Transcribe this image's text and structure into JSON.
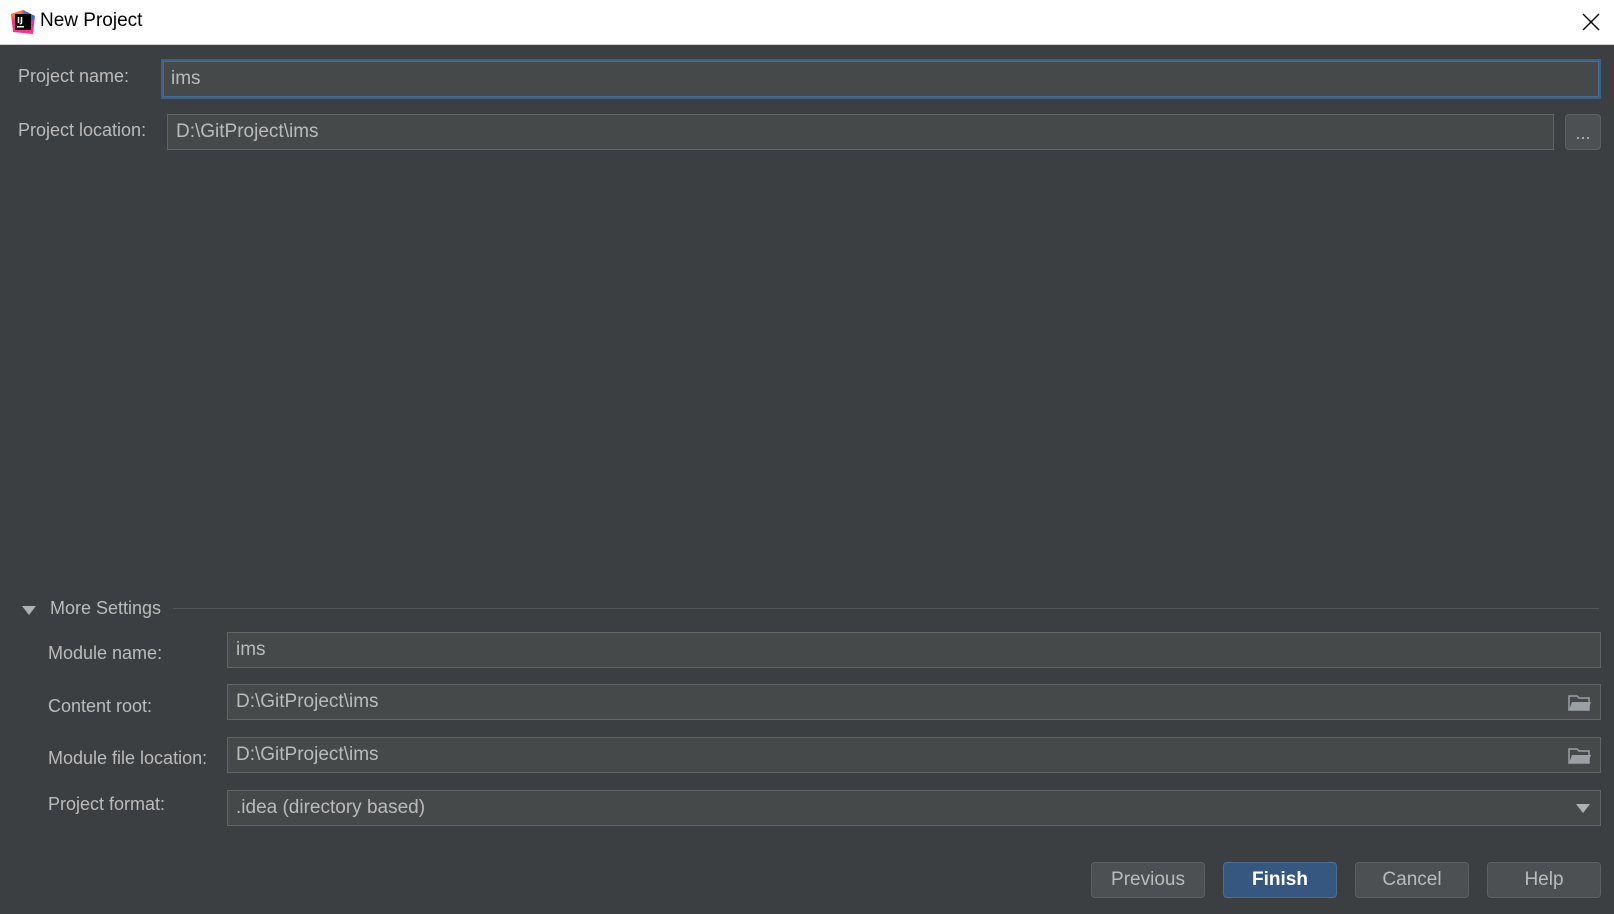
{
  "window": {
    "title": "New Project",
    "icon": "intellij-idea-icon"
  },
  "project_name": {
    "label": "Project name:",
    "value": "ims"
  },
  "project_location": {
    "label": "Project location:",
    "value": "D:\\GitProject\\ims",
    "browse_label": "..."
  },
  "more_settings": {
    "label": "More Settings",
    "expanded": true,
    "module_name": {
      "label": "Module name:",
      "value": "ims"
    },
    "content_root": {
      "label": "Content root:",
      "value": "D:\\GitProject\\ims"
    },
    "module_file_location": {
      "label": "Module file location:",
      "value": "D:\\GitProject\\ims"
    },
    "project_format": {
      "label": "Project format:",
      "value": ".idea (directory based)"
    }
  },
  "buttons": {
    "previous": "Previous",
    "finish": "Finish",
    "cancel": "Cancel",
    "help": "Help"
  },
  "colors": {
    "background": "#3c3f41",
    "field": "#45494a",
    "focus_border": "#3d6185",
    "primary_button": "#365880"
  }
}
